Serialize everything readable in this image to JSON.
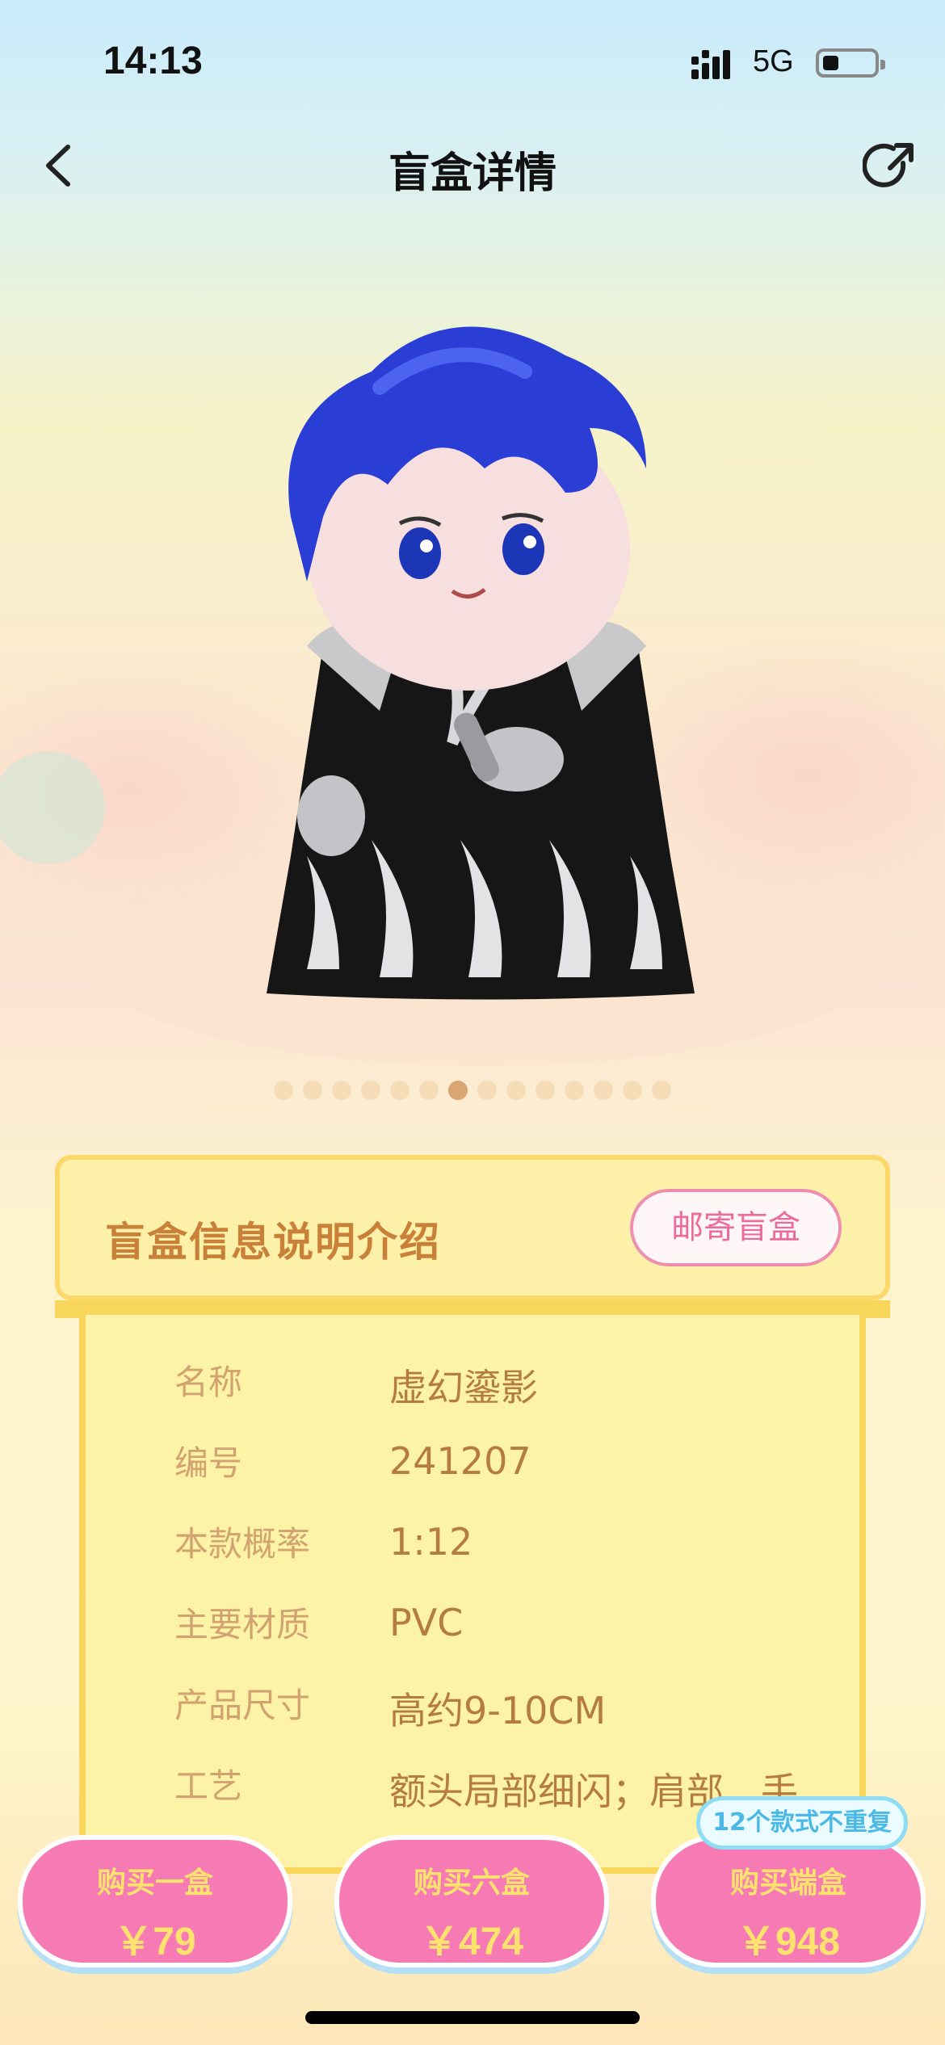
{
  "status_bar": {
    "time": "14:13",
    "network": "5G",
    "battery_level": 0.3
  },
  "header": {
    "title": "盲盒详情"
  },
  "gallery": {
    "count": 14,
    "active_index": 6
  },
  "info_card": {
    "title": "盲盒信息说明介绍",
    "mail_button": "邮寄盲盒",
    "rows": [
      {
        "key": "名称",
        "value": "虚幻鎏影"
      },
      {
        "key": "编号",
        "value": "241207"
      },
      {
        "key": "本款概率",
        "value": "1:12"
      },
      {
        "key": "主要材质",
        "value": "PVC"
      },
      {
        "key": "产品尺寸",
        "value": "高约9-10CM"
      },
      {
        "key": "工艺",
        "value": "额头局部细闪；肩部、手"
      }
    ]
  },
  "actions": [
    {
      "label": "购买一盒",
      "price": "￥79"
    },
    {
      "label": "购买六盒",
      "price": "￥474"
    },
    {
      "label": "购买端盒",
      "price": "￥948"
    }
  ],
  "badge": "12个款式不重复",
  "colors": {
    "accent_pink": "#f67bb5",
    "accent_yellow": "#fde26e",
    "card_border": "#f8d65b",
    "label_brown": "#c98139"
  }
}
